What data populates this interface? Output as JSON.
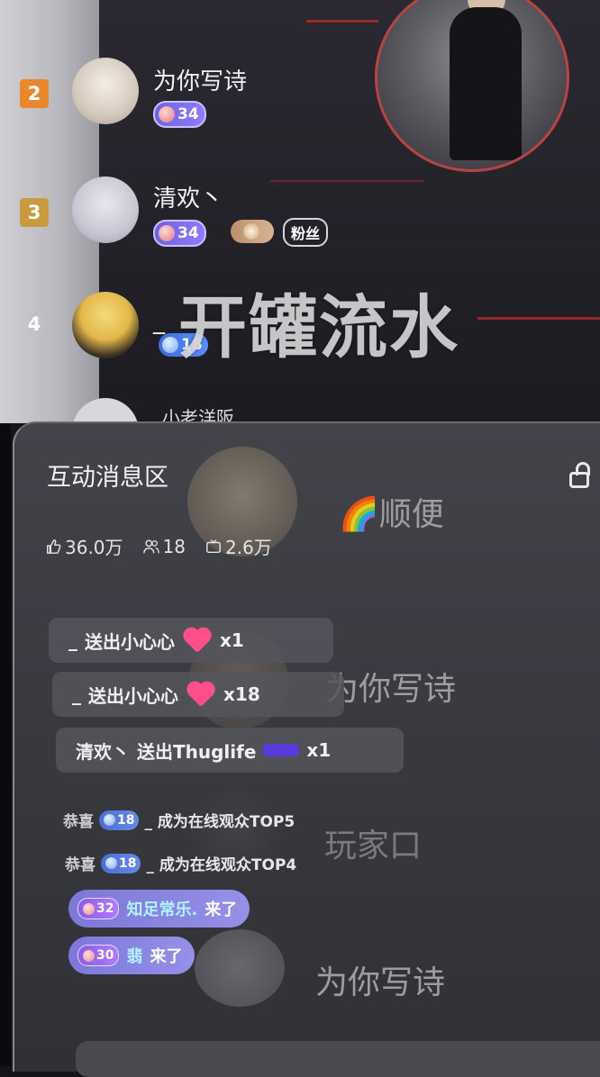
{
  "rank_list": [
    {
      "rank": "2",
      "name": "为你写诗",
      "badges": [
        {
          "type": "level",
          "value": "34"
        }
      ]
    },
    {
      "rank": "3",
      "name": "清欢丶",
      "badges": [
        {
          "type": "level",
          "value": "34"
        },
        {
          "type": "club",
          "value": ""
        },
        {
          "type": "fan",
          "value": "粉丝"
        }
      ]
    },
    {
      "rank": "4",
      "name": "_",
      "badges": [
        {
          "type": "level",
          "value": "18"
        }
      ]
    },
    {
      "rank": "",
      "name": "小老洋阪",
      "badges": []
    }
  ],
  "overlay_title": "开罐流水",
  "panel": {
    "title": "互动消息区",
    "stats": {
      "likes": "36.0万",
      "online": "18",
      "viewers": "2.6万"
    }
  },
  "watermarks": {
    "w1": "🌈顺便",
    "w2": "为你写诗",
    "w3": "玩家口",
    "w4": "为你写诗"
  },
  "gifts": [
    {
      "user": "_",
      "action": "送出小心心",
      "count": "x1",
      "icon": "heart-icon"
    },
    {
      "user": "_",
      "action": "送出小心心",
      "count": "x18",
      "icon": "heart-icon"
    },
    {
      "user": "清欢丶",
      "action": "送出Thuglife",
      "count": "x1",
      "icon": "glasses-icon"
    }
  ],
  "system_messages": [
    {
      "prefix": "恭喜",
      "badge": "18",
      "text": "_ 成为在线观众TOP5"
    },
    {
      "prefix": "恭喜",
      "badge": "18",
      "text": "_ 成为在线观众TOP4"
    }
  ],
  "entries": [
    {
      "badge": "32",
      "name": "知足常乐.",
      "action": "来了"
    },
    {
      "badge": "30",
      "name": "翡",
      "action": "来了"
    }
  ],
  "colors": {
    "accent_purple": "#8e7cff",
    "rank2_badge": "#e8872c",
    "rank3_badge": "#c99a3e",
    "stage_red": "#b02a2a"
  }
}
